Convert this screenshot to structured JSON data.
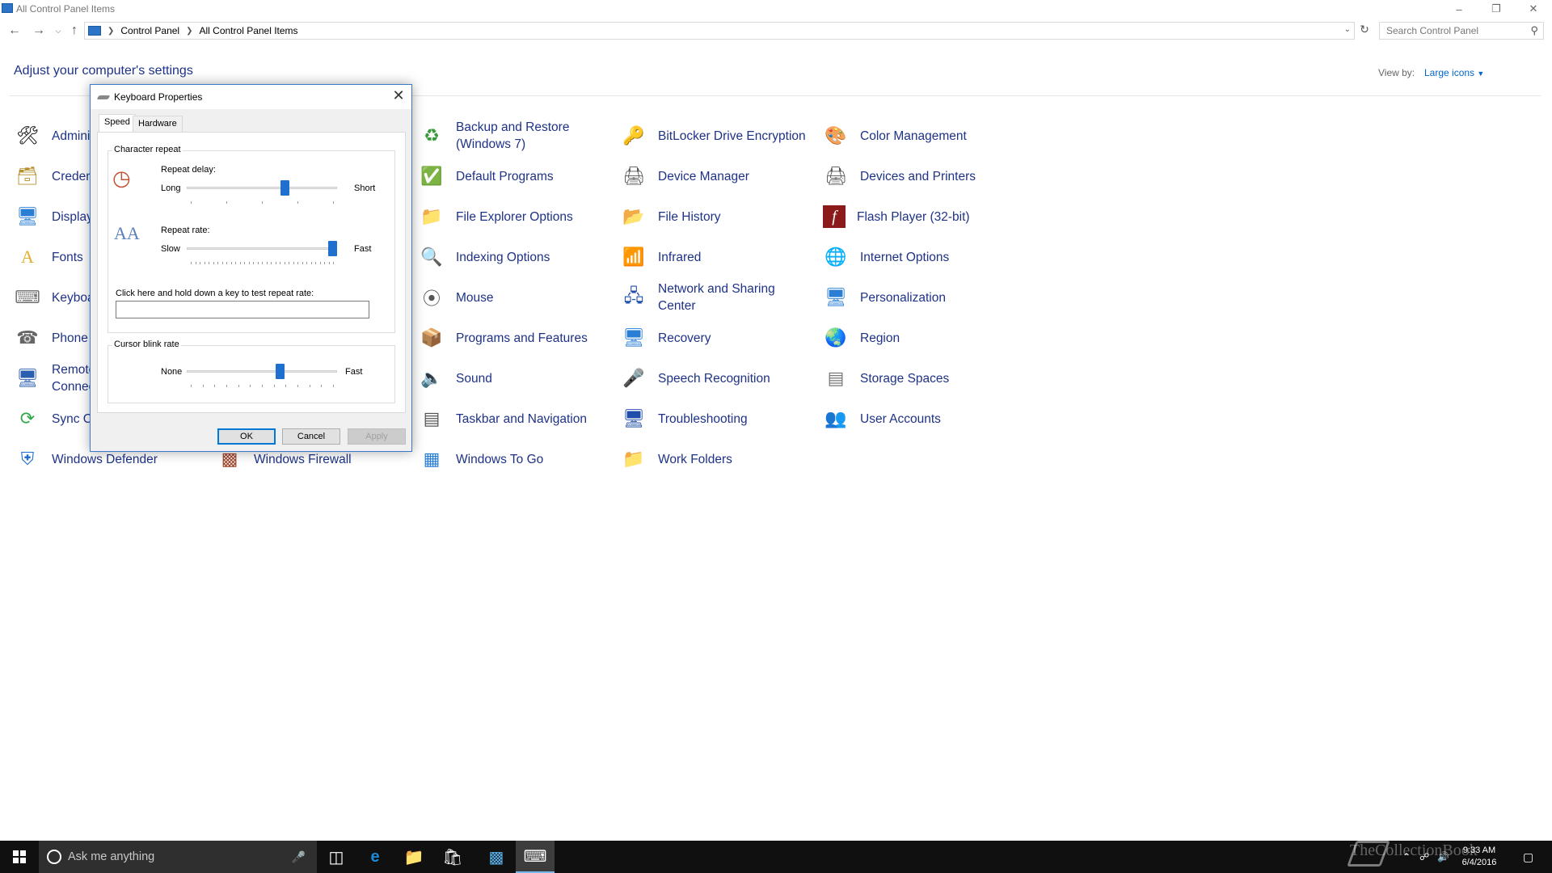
{
  "window": {
    "title": "All Control Panel Items",
    "minimize_icon": "minimize-icon",
    "maximize_icon": "restore-icon",
    "close_icon": "close-icon"
  },
  "address": {
    "crumbs": [
      "Control Panel",
      "All Control Panel Items"
    ],
    "search_placeholder": "Search Control Panel"
  },
  "header": {
    "title": "Adjust your computer's settings",
    "view_by_label": "View by:",
    "view_by_value": "Large icons"
  },
  "items": [
    {
      "label": "Admini",
      "icon": "administrative-tools-icon"
    },
    {
      "label": "Creden",
      "icon": "credential-manager-icon"
    },
    {
      "label": "Display",
      "icon": "display-icon"
    },
    {
      "label": "Fonts",
      "icon": "fonts-icon"
    },
    {
      "label": "Keyboa",
      "icon": "keyboard-icon"
    },
    {
      "label": "Phone",
      "icon": "phone-modem-icon"
    },
    {
      "label": "Remote Connec",
      "icon": "remoteapp-icon"
    },
    {
      "label": "Sync C",
      "icon": "sync-center-icon"
    },
    {
      "label": "Windows Defender",
      "icon": "windows-defender-icon"
    },
    {
      "label": "Windows Firewall",
      "icon": "windows-firewall-icon"
    },
    {
      "label": "Backup and Restore (Windows 7)",
      "icon": "backup-restore-icon"
    },
    {
      "label": "Default Programs",
      "icon": "default-programs-icon"
    },
    {
      "label": "File Explorer Options",
      "icon": "file-explorer-options-icon"
    },
    {
      "label": "Indexing Options",
      "icon": "indexing-options-icon"
    },
    {
      "label": "Mouse",
      "icon": "mouse-icon"
    },
    {
      "label": "Programs and Features",
      "icon": "programs-features-icon"
    },
    {
      "label": "Sound",
      "icon": "sound-icon"
    },
    {
      "label": "Taskbar and Navigation",
      "icon": "taskbar-navigation-icon"
    },
    {
      "label": "Windows To Go",
      "icon": "windows-to-go-icon"
    },
    {
      "label": "BitLocker Drive Encryption",
      "icon": "bitlocker-icon"
    },
    {
      "label": "Device Manager",
      "icon": "device-manager-icon"
    },
    {
      "label": "File History",
      "icon": "file-history-icon"
    },
    {
      "label": "Infrared",
      "icon": "infrared-icon"
    },
    {
      "label": "Network and Sharing Center",
      "icon": "network-sharing-icon"
    },
    {
      "label": "Recovery",
      "icon": "recovery-icon"
    },
    {
      "label": "Speech Recognition",
      "icon": "speech-recognition-icon"
    },
    {
      "label": "Troubleshooting",
      "icon": "troubleshooting-icon"
    },
    {
      "label": "Work Folders",
      "icon": "work-folders-icon"
    },
    {
      "label": "Color Management",
      "icon": "color-management-icon"
    },
    {
      "label": "Devices and Printers",
      "icon": "devices-printers-icon"
    },
    {
      "label": "Flash Player (32-bit)",
      "icon": "flash-player-icon"
    },
    {
      "label": "Internet Options",
      "icon": "internet-options-icon"
    },
    {
      "label": "Personalization",
      "icon": "personalization-icon"
    },
    {
      "label": "Region",
      "icon": "region-icon"
    },
    {
      "label": "Storage Spaces",
      "icon": "storage-spaces-icon"
    },
    {
      "label": "User Accounts",
      "icon": "user-accounts-icon"
    }
  ],
  "dialog": {
    "title": "Keyboard Properties",
    "tabs": [
      "Speed",
      "Hardware"
    ],
    "character_repeat": {
      "legend": "Character repeat",
      "repeat_delay_label": "Repeat delay:",
      "delay_left": "Long",
      "delay_right": "Short",
      "delay_value": 0.66,
      "repeat_rate_label": "Repeat rate:",
      "rate_left": "Slow",
      "rate_right": "Fast",
      "rate_value": 1.0,
      "test_label": "Click here and hold down a key to test repeat rate:"
    },
    "cursor_blink": {
      "legend": "Cursor blink rate",
      "left": "None",
      "right": "Fast",
      "value": 0.63
    },
    "buttons": {
      "ok": "OK",
      "cancel": "Cancel",
      "apply": "Apply"
    }
  },
  "taskbar": {
    "search_text": "Ask me anything",
    "clock_time": "9:33 AM",
    "clock_date": "6/4/2016",
    "watermark": "TheCollectionBook"
  }
}
